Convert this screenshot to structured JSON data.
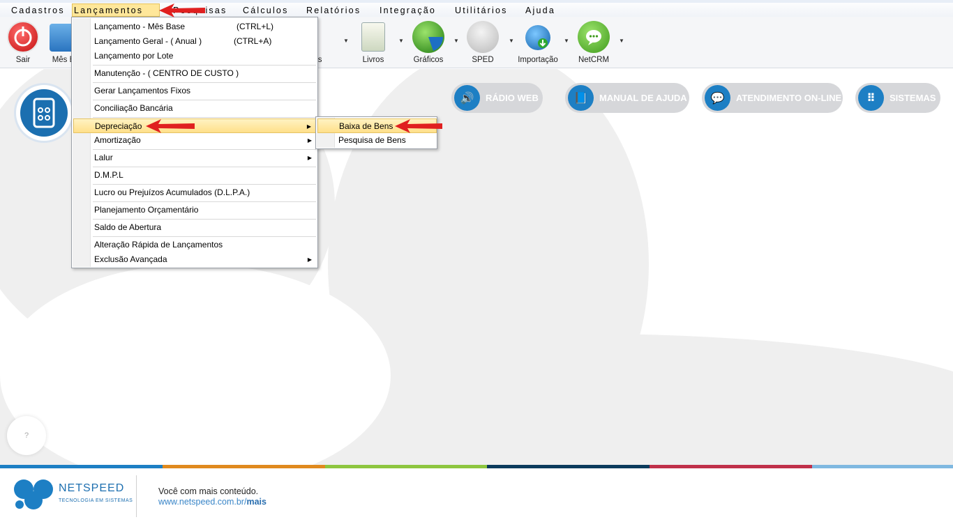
{
  "menubar": {
    "items": [
      {
        "label": "Cadastros",
        "active": false
      },
      {
        "label": "Lançamentos",
        "active": true
      },
      {
        "label": "Pesquisas",
        "active": false
      },
      {
        "label": "Cálculos",
        "active": false
      },
      {
        "label": "Relatórios",
        "active": false
      },
      {
        "label": "Integração",
        "active": false
      },
      {
        "label": "Utilitários",
        "active": false
      },
      {
        "label": "Ajuda",
        "active": false
      }
    ]
  },
  "toolbar": {
    "buttons": [
      {
        "label": "Sair",
        "icon": "power-icon"
      },
      {
        "label": "Mês B",
        "icon": "calendar-icon"
      },
      {
        "label": "ulos",
        "icon": "calculator-icon"
      },
      {
        "label": "Livros",
        "icon": "books-icon"
      },
      {
        "label": "Gráficos",
        "icon": "pie-chart-icon"
      },
      {
        "label": "SPED",
        "icon": "sped-icon"
      },
      {
        "label": "Importação",
        "icon": "globe-download-icon"
      },
      {
        "label": "NetCRM",
        "icon": "chat-icon"
      }
    ]
  },
  "dropdown": {
    "items": [
      {
        "label": "Lançamento - Mês Base",
        "shortcut": "(CTRL+L)"
      },
      {
        "label": "Lançamento Geral - ( Anual )",
        "shortcut": "(CTRL+A)"
      },
      {
        "label": "Lançamento por Lote",
        "shortcut": ""
      },
      {
        "label": "Manutenção - ( CENTRO DE CUSTO )",
        "shortcut": ""
      },
      {
        "label": "Gerar Lançamentos Fixos",
        "shortcut": ""
      },
      {
        "label": "Conciliação Bancária",
        "shortcut": ""
      },
      {
        "label": "Depreciação",
        "shortcut": ""
      },
      {
        "label": "Amortização",
        "shortcut": ""
      },
      {
        "label": "Lalur",
        "shortcut": ""
      },
      {
        "label": "D.M.P.L",
        "shortcut": ""
      },
      {
        "label": "Lucro ou Prejuízos Acumulados (D.L.P.A.)",
        "shortcut": ""
      },
      {
        "label": "Planejamento Orçamentário",
        "shortcut": ""
      },
      {
        "label": "Saldo de Abertura",
        "shortcut": ""
      },
      {
        "label": "Alteração Rápida de Lançamentos",
        "shortcut": ""
      },
      {
        "label": "Exclusão Avançada",
        "shortcut": ""
      }
    ]
  },
  "submenu": {
    "items": [
      {
        "label": "Baixa de Bens"
      },
      {
        "label": "Pesquisa de Bens"
      }
    ]
  },
  "quicklinks": {
    "radio": "RÁDIO WEB",
    "manual": "MANUAL DE AJUDA",
    "atendimento": "ATENDIMENTO ON-LINE",
    "sistemas": "SISTEMAS"
  },
  "help": {
    "label": "?"
  },
  "footer": {
    "brand": "NETSPEED",
    "brand_sub": "TECNOLOGIA EM SISTEMAS",
    "message": "Você com mais conteúdo.",
    "link_prefix": "www.netspeed.com.br/",
    "link_suffix": "mais"
  },
  "colors": {
    "accent_blue": "#1d7fc4",
    "annotation_red": "#e02020",
    "menu_highlight": "#ffe08a",
    "strip": [
      "#1d7fc4",
      "#e08a1e",
      "#8dc63f",
      "#0b3b5c",
      "#c0304a",
      "#7fb8e0"
    ]
  }
}
